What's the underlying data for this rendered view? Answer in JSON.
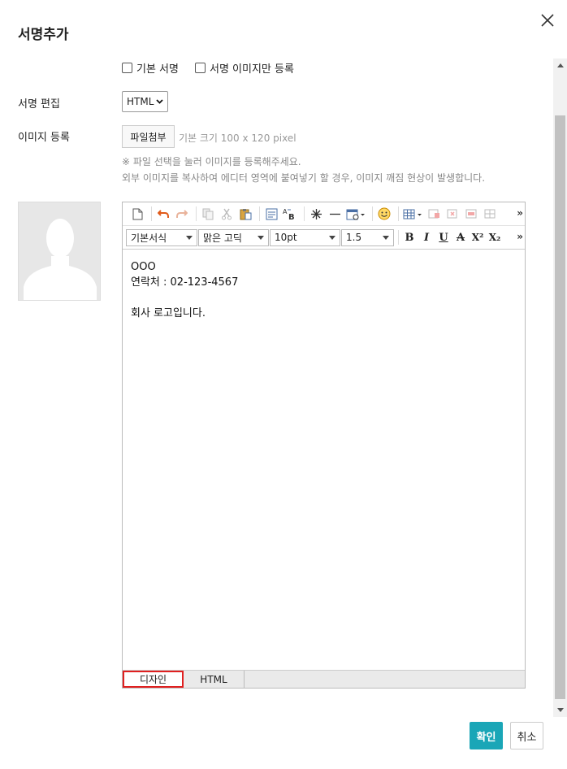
{
  "dialog": {
    "title": "서명추가",
    "close_icon": "close-icon"
  },
  "options": {
    "default_signature": "기본 서명",
    "image_only": "서명 이미지만 등록"
  },
  "edit": {
    "label": "서명 편집",
    "mode_value": "HTML"
  },
  "image": {
    "label": "이미지 등록",
    "file_button": "파일첨부",
    "size_hint": "기본 크기 100 x 120 pixel",
    "notice_1": "※ 파일 선택을 눌러 이미지를 등록해주세요.",
    "notice_2": "외부 이미지를 복사하여 에디터 영역에 붙여넣기 할 경우, 이미지 깨짐 현상이 발생합니다."
  },
  "editor": {
    "toolbar": {
      "style": "기본서식",
      "font": "맑은 고딕",
      "size": "10pt",
      "line_height": "1.5",
      "more": "»",
      "bold": "B",
      "italic": "I",
      "underline": "U",
      "strike": "A",
      "superscript": "X²",
      "subscript": "X₂"
    },
    "content": {
      "line1": "OOO",
      "line2": "연락처 : 02-123-4567",
      "line3": "",
      "line4": "회사 로고입니다."
    },
    "tabs": {
      "design": "디자인",
      "html": "HTML"
    }
  },
  "buttons": {
    "ok": "확인",
    "cancel": "취소"
  },
  "colors": {
    "accent": "#1aa6b7",
    "active_tab_border": "#e02020"
  }
}
